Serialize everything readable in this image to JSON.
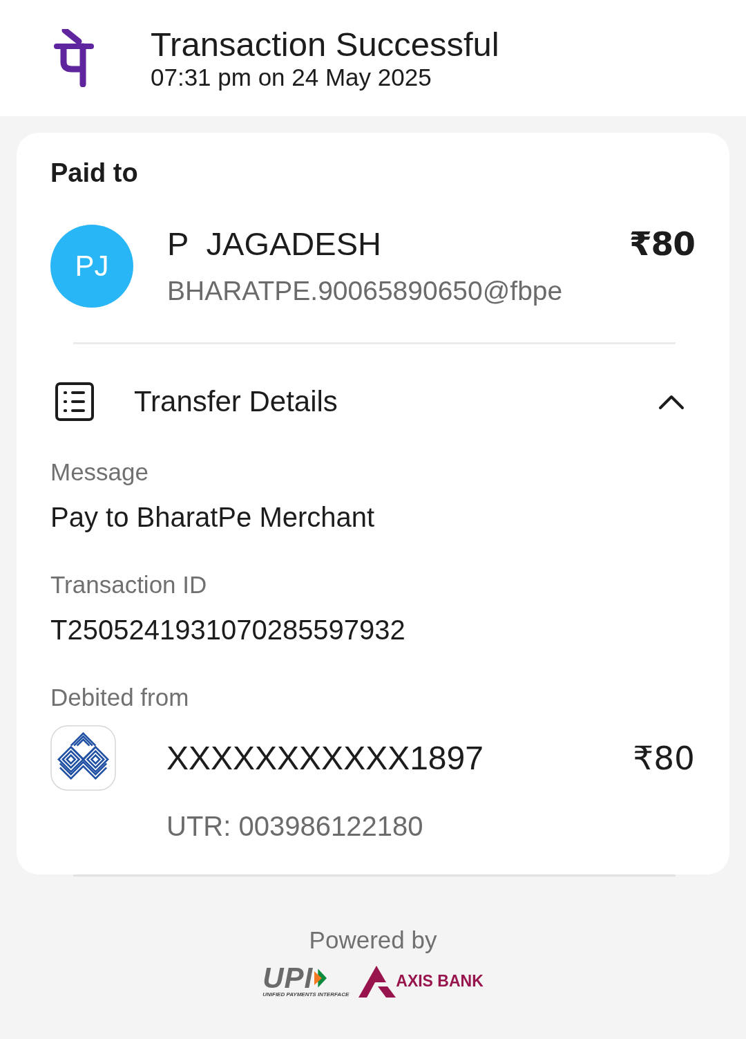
{
  "header": {
    "title": "Transaction Successful",
    "datetime": "07:31 pm on 24 May 2025"
  },
  "paid_to": {
    "heading": "Paid to",
    "avatar_initials": "PJ",
    "name": "P  JAGADESH",
    "upi_id": "BHARATPE.90065890650@fbpe",
    "amount": "₹80"
  },
  "transfer_details": {
    "title": "Transfer Details",
    "expanded": true,
    "fields": [
      {
        "label": "Message",
        "value": "Pay to BharatPe Merchant"
      },
      {
        "label": "Transaction ID",
        "value": "T2505241931070285597932"
      }
    ],
    "debited_from": {
      "label": "Debited from",
      "account": "XXXXXXXXXXX1897",
      "amount": "₹80",
      "utr": "UTR: 003986122180"
    }
  },
  "footer": {
    "powered_by": "Powered by",
    "upi_text": "UPI",
    "upi_tagline": "UNIFIED PAYMENTS INTERFACE",
    "bank_name": "AXIS BANK"
  }
}
